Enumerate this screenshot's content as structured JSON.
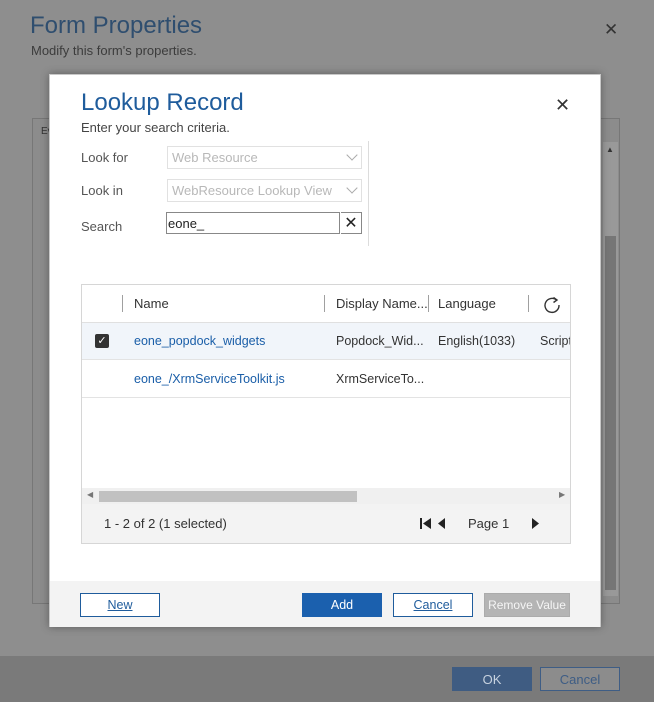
{
  "background_dialog": {
    "title": "Form Properties",
    "subtitle": "Modify this form's properties.",
    "panel_fragment": "Ev",
    "ok_label": "OK",
    "cancel_label": "Cancel"
  },
  "lookup": {
    "title": "Lookup Record",
    "subtitle": "Enter your search criteria.",
    "look_for_label": "Look for",
    "look_for_value": "Web Resource",
    "look_in_label": "Look in",
    "look_in_value": "WebResource Lookup View",
    "search_label": "Search",
    "search_value": "eone_"
  },
  "grid": {
    "columns": [
      "Name",
      "Display Name...",
      "Language"
    ],
    "rows": [
      {
        "name": "eone_popdock_widgets",
        "display_name": "Popdock_Wid...",
        "language": "English(1033)",
        "type": "Script",
        "selected": true
      },
      {
        "name": "eone_/XrmServiceToolkit.js",
        "display_name": "XrmServiceTo...",
        "language": "",
        "type": "",
        "selected": false
      }
    ],
    "status": "1 - 2 of 2 (1 selected)",
    "page_label": "Page 1"
  },
  "buttons": {
    "new": "New",
    "add": "Add",
    "cancel": "Cancel",
    "remove": "Remove Value"
  },
  "colors": {
    "accent": "#1b60ae",
    "link": "#1a5ea8",
    "title": "#1f5c9c"
  },
  "icons": {
    "close": "close-icon",
    "clear": "clear-icon",
    "refresh": "refresh-icon",
    "checkbox": "checkbox-checked-icon",
    "first_page": "first-page-icon",
    "prev_page": "prev-page-icon",
    "next_page": "next-page-icon"
  }
}
